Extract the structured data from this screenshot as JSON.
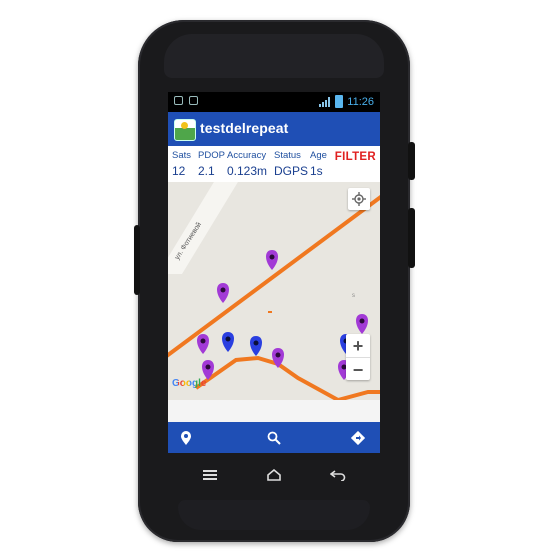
{
  "statusbar": {
    "time": "11:26"
  },
  "app": {
    "title": "testdelrepeat"
  },
  "gps": {
    "labels": [
      "Sats",
      "PDOP",
      "Accuracy",
      "Status",
      "Age"
    ],
    "values": [
      "12",
      "2.1",
      "0.123m",
      "DGPS",
      "1s"
    ],
    "filter_label": "FILTER"
  },
  "map": {
    "street_label": "ул. Фотиевой",
    "zoom_in": "+",
    "zoom_out": "−",
    "attribution": "Google",
    "scale_letter": "s"
  },
  "bottom_bar": {
    "icons": [
      "pin-icon",
      "search-icon",
      "navigate-icon"
    ]
  },
  "android_nav": {
    "icons": [
      "menu-icon",
      "home-icon",
      "back-icon"
    ]
  },
  "colors": {
    "appbar": "#1f4fb5",
    "track": "#f07820",
    "marker_purple": "#a23ad6",
    "marker_blue": "#2a3fe0",
    "filter": "#e02020"
  }
}
